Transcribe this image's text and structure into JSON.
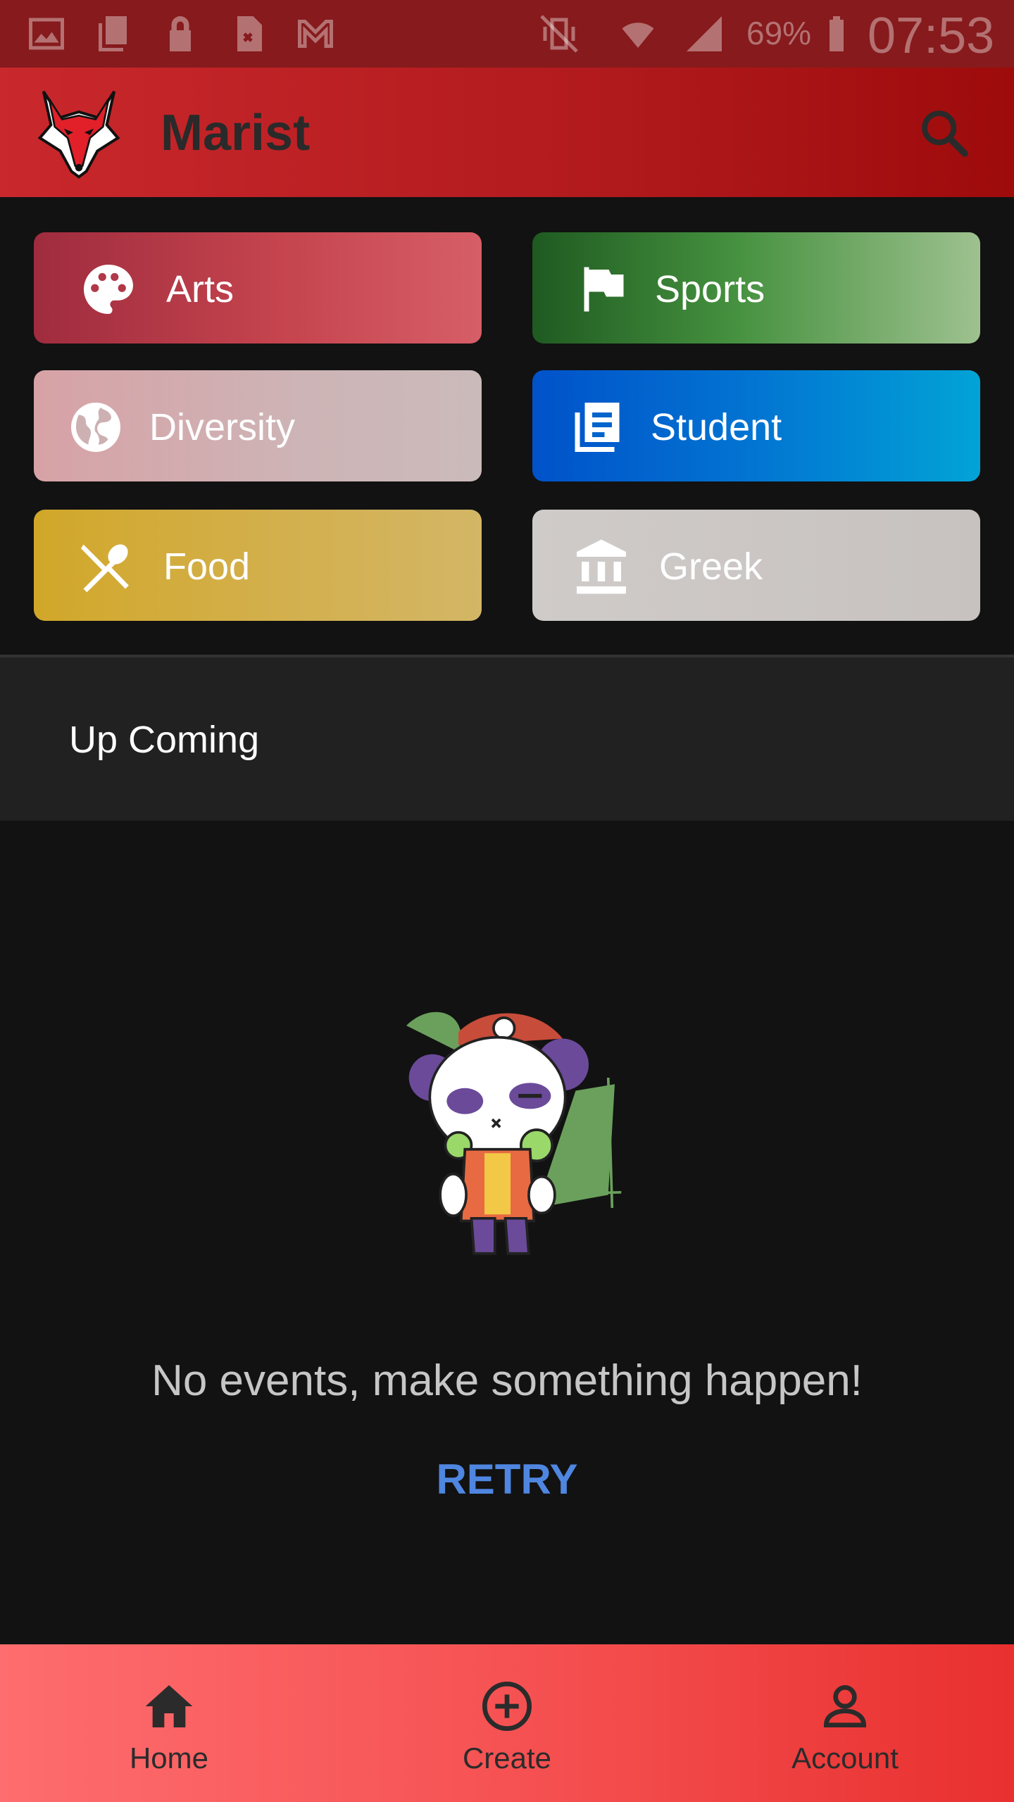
{
  "status_bar": {
    "battery_percent": "69%",
    "time": "07:53"
  },
  "app_bar": {
    "title": "Marist",
    "search_icon": "search-icon",
    "logo": "red-fox-logo"
  },
  "categories": [
    {
      "label": "Arts",
      "icon": "palette-icon"
    },
    {
      "label": "Sports",
      "icon": "flag-icon"
    },
    {
      "label": "Diversity",
      "icon": "globe-icon"
    },
    {
      "label": "Student",
      "icon": "newspaper-icon"
    },
    {
      "label": "Food",
      "icon": "utensils-icon"
    },
    {
      "label": "Greek",
      "icon": "institution-icon"
    }
  ],
  "upcoming": {
    "label": "Up Coming"
  },
  "empty_state": {
    "illustration": "panda-illustration",
    "message": "No events, make something happen!",
    "retry_label": "RETRY"
  },
  "bottom_nav": {
    "items": [
      {
        "label": "Home",
        "icon": "home-icon"
      },
      {
        "label": "Create",
        "icon": "add-circle-icon"
      },
      {
        "label": "Account",
        "icon": "account-icon"
      }
    ]
  },
  "colors": {
    "app_bar": "#b11a1d",
    "background": "#121212",
    "retry": "#4f86e0",
    "bottom_nav": "#f54f50"
  }
}
